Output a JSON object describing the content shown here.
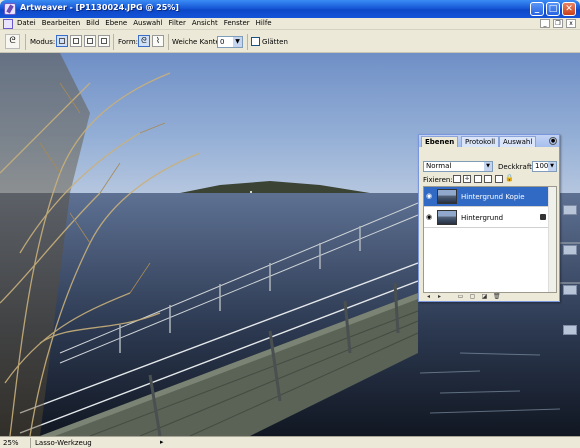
{
  "window": {
    "title": "Artweaver - [P1130024.JPG @ 25%]",
    "buttons": {
      "minimize": "_",
      "maximize": "□",
      "close": "✕"
    }
  },
  "menubar": {
    "items": [
      "Datei",
      "Bearbeiten",
      "Bild",
      "Ebene",
      "Auswahl",
      "Filter",
      "Ansicht",
      "Fenster",
      "Hilfe"
    ],
    "mdi": {
      "minimize": "_",
      "restore": "❐",
      "close": "x"
    }
  },
  "options": {
    "tool_icon": "lasso-icon",
    "mode_label": "Modus:",
    "form_label": "Form:",
    "feather_label": "Weiche Kante:",
    "feather_value": "0",
    "smooth_label": "Glätten",
    "smooth_checked": false
  },
  "layers_panel": {
    "tabs": [
      "Ebenen",
      "Protokoll",
      "Auswahl"
    ],
    "active_tab": "Ebenen",
    "blend_mode": "Normal",
    "opacity_label": "Deckkraft:",
    "opacity_value": "100",
    "lock_label": "Fixieren:",
    "layers": [
      {
        "name": "Hintergrund Kopie",
        "selected": true,
        "locked": false
      },
      {
        "name": "Hintergrund",
        "selected": false,
        "locked": true
      }
    ],
    "bottom_icons": [
      "arrow-left-icon",
      "arrow-right-icon",
      "folder-icon",
      "new-layer-icon",
      "trash-icon"
    ]
  },
  "statusbar": {
    "zoom": "25%",
    "tool": "Lasso-Werkzeug",
    "arrow": "▸"
  },
  "colors": {
    "titlebar": "#1859d8",
    "selection": "#316ac5",
    "chrome": "#ece9d8"
  }
}
